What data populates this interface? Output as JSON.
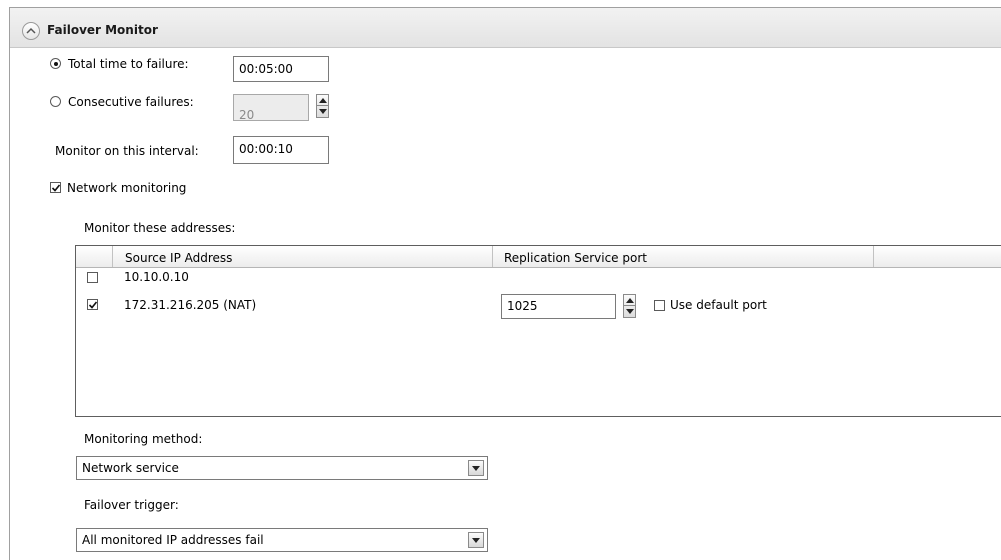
{
  "panel": {
    "title": "Failover Monitor"
  },
  "failure_mode": {
    "selected": "total_time",
    "total_time": {
      "label": "Total time to failure:",
      "value": "00:05:00"
    },
    "consecutive": {
      "label": "Consecutive failures:",
      "value": "20"
    }
  },
  "interval": {
    "label": "Monitor on this interval:",
    "value": "00:00:10"
  },
  "network_monitoring": {
    "label": "Network monitoring",
    "checked": true
  },
  "addresses": {
    "label": "Monitor these addresses:",
    "columns": [
      "Source IP Address",
      "Replication Service port"
    ],
    "rows": [
      {
        "ip": "10.10.0.10",
        "checked": false
      },
      {
        "ip": "172.31.216.205 (NAT)",
        "checked": true,
        "port": "1025",
        "use_default_label": "Use default port",
        "use_default": false
      }
    ]
  },
  "monitoring_method": {
    "label": "Monitoring method:",
    "value": "Network service"
  },
  "failover_trigger": {
    "label": "Failover trigger:",
    "value": "All monitored IP addresses fail"
  },
  "colors": {
    "header_bg": "#e8e8e8",
    "border": "#7a7a7a",
    "disabled_bg": "#ececec"
  }
}
